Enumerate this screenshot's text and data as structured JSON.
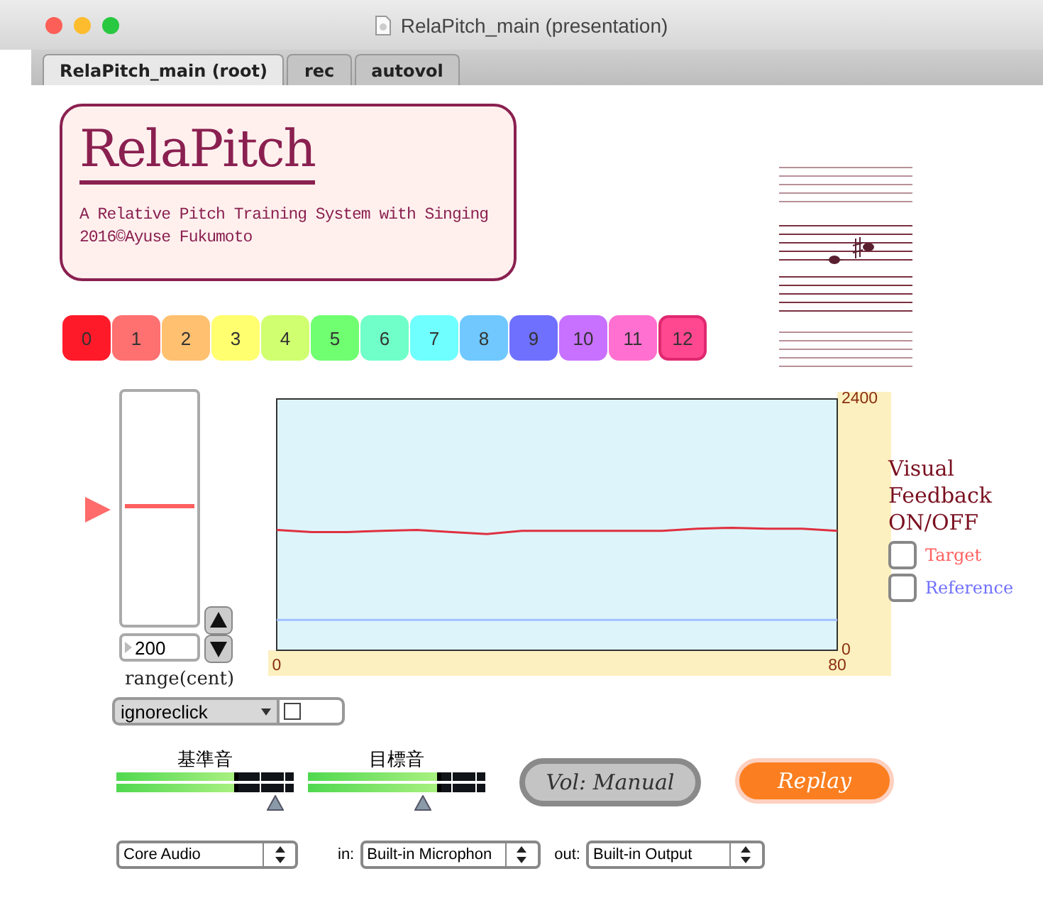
{
  "window": {
    "title": "RelaPitch_main (presentation)"
  },
  "tabs": [
    {
      "label": "RelaPitch_main (root)",
      "selected": true
    },
    {
      "label": "rec",
      "selected": false
    },
    {
      "label": "autovol",
      "selected": false
    }
  ],
  "header": {
    "title": "RelaPitch",
    "subtitle": "A Relative Pitch Training System with Singing",
    "credit": "2016©Ayuse Fukumoto"
  },
  "interval_buttons": [
    {
      "label": "0",
      "color": "#ff1a2a",
      "selected": false
    },
    {
      "label": "1",
      "color": "#ff7070",
      "selected": false
    },
    {
      "label": "2",
      "color": "#ffc070",
      "selected": false
    },
    {
      "label": "3",
      "color": "#ffff70",
      "selected": false
    },
    {
      "label": "4",
      "color": "#d0ff70",
      "selected": false
    },
    {
      "label": "5",
      "color": "#70ff70",
      "selected": false
    },
    {
      "label": "6",
      "color": "#70ffc8",
      "selected": false
    },
    {
      "label": "7",
      "color": "#70ffff",
      "selected": false
    },
    {
      "label": "8",
      "color": "#70c8ff",
      "selected": false
    },
    {
      "label": "9",
      "color": "#7070ff",
      "selected": false
    },
    {
      "label": "10",
      "color": "#c870ff",
      "selected": false
    },
    {
      "label": "11",
      "color": "#ff70d0",
      "selected": false
    },
    {
      "label": "12",
      "color": "#ff4890",
      "selected": true
    }
  ],
  "range_slider": {
    "level": 0.5,
    "value": "200",
    "label": "range(cent)"
  },
  "ignoreclick": {
    "value": "ignoreclick",
    "checked": false
  },
  "pitch_plot": {
    "chart_data": {
      "type": "line",
      "x": [
        0,
        5,
        10,
        15,
        20,
        25,
        30,
        35,
        40,
        45,
        50,
        55,
        60,
        65,
        70,
        75,
        80
      ],
      "xlim": [
        0,
        80
      ],
      "ylim": [
        0,
        2400
      ],
      "xticks": [
        0,
        80
      ],
      "yticks": [
        0,
        2400
      ],
      "series": [
        {
          "color": "#e03040",
          "values": [
            1150,
            1130,
            1130,
            1140,
            1150,
            1130,
            1110,
            1140,
            1140,
            1140,
            1140,
            1140,
            1160,
            1170,
            1160,
            1160,
            1140
          ]
        },
        {
          "color": "#a0c0ff",
          "values": [
            290,
            290,
            290,
            290,
            290,
            290,
            290,
            290,
            290,
            290,
            290,
            290,
            290,
            290,
            290,
            290,
            290
          ]
        }
      ]
    }
  },
  "feedback": {
    "title": "Visual Feedback ON/OFF",
    "options": [
      {
        "label": "Target",
        "color": "#ff6060",
        "checked": false
      },
      {
        "label": "Reference",
        "color": "#7070ff",
        "checked": false
      }
    ]
  },
  "meters": [
    {
      "label": "基準音",
      "level": 0.69
    },
    {
      "label": "目標音",
      "level": 0.75
    }
  ],
  "vol_button": {
    "label": "Vol: Manual"
  },
  "replay_button": {
    "label": "Replay"
  },
  "audio": {
    "driver": "Core Audio",
    "in_label": "in:",
    "input": "Built-in Microphon",
    "out_label": "out:",
    "output": "Built-in Output"
  }
}
